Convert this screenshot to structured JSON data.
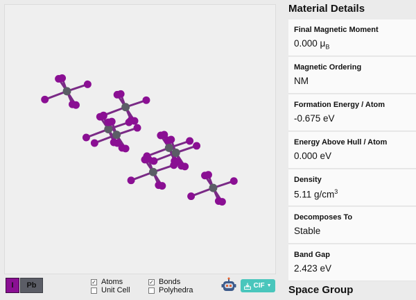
{
  "elements": [
    {
      "symbol": "I",
      "color": "#8a0f93"
    },
    {
      "symbol": "Pb",
      "color": "#5b5d66"
    }
  ],
  "options": {
    "atoms": {
      "label": "Atoms",
      "checked": true
    },
    "unit_cell": {
      "label": "Unit Cell",
      "checked": false
    },
    "bonds": {
      "label": "Bonds",
      "checked": true
    },
    "polyhedra": {
      "label": "Polyhedra",
      "checked": false
    }
  },
  "download": {
    "label": "CIF"
  },
  "details": {
    "title": "Material Details",
    "items": [
      {
        "label": "Final Magnetic Moment",
        "value": "0.000 μ",
        "sub": "B"
      },
      {
        "label": "Magnetic Ordering",
        "value": "NM"
      },
      {
        "label": "Formation Energy / Atom",
        "value": "-0.675 eV"
      },
      {
        "label": "Energy Above Hull / Atom",
        "value": "0.000 eV"
      },
      {
        "label": "Density",
        "value": "5.11 g/cm",
        "sup": "3"
      },
      {
        "label": "Decomposes To",
        "value": "Stable"
      },
      {
        "label": "Band Gap",
        "value": "2.423 eV"
      }
    ]
  },
  "space_group": {
    "title": "Space Group"
  }
}
